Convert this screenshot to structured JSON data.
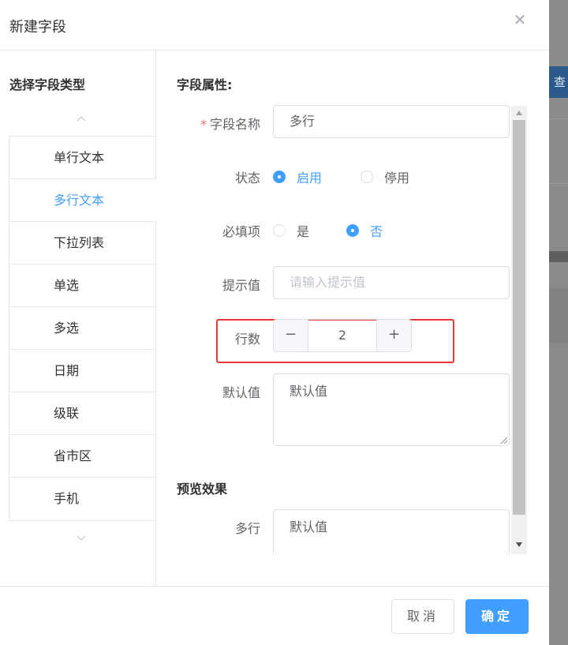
{
  "background": {
    "button_label": "查"
  },
  "dialog": {
    "title": "新建字段",
    "close_icon": "close-icon",
    "left_panel": {
      "heading": "选择字段类型",
      "types": [
        "单行文本",
        "多行文本",
        "下拉列表",
        "单选",
        "多选",
        "日期",
        "级联",
        "省市区",
        "手机"
      ],
      "active_type": "多行文本"
    },
    "form": {
      "section_title": "字段属性:",
      "field_name_label": "字段名称",
      "field_name_value": "多行",
      "status_label": "状态",
      "status_options": [
        "启用",
        "停用"
      ],
      "status_selected": "启用",
      "required_label": "必填项",
      "required_options": [
        "是",
        "否"
      ],
      "required_selected": "否",
      "hint_label": "提示值",
      "hint_placeholder": "请输入提示值",
      "rows_label": "行数",
      "rows_value": "2",
      "default_label": "默认值",
      "default_value": "默认值",
      "preview_title": "预览效果",
      "preview_label": "多行",
      "preview_value": "默认值"
    },
    "footer": {
      "cancel": "取消",
      "confirm": "确定"
    },
    "colors": {
      "primary": "#409eff",
      "required_star": "#f56c6c",
      "highlight": "#e53935"
    }
  }
}
